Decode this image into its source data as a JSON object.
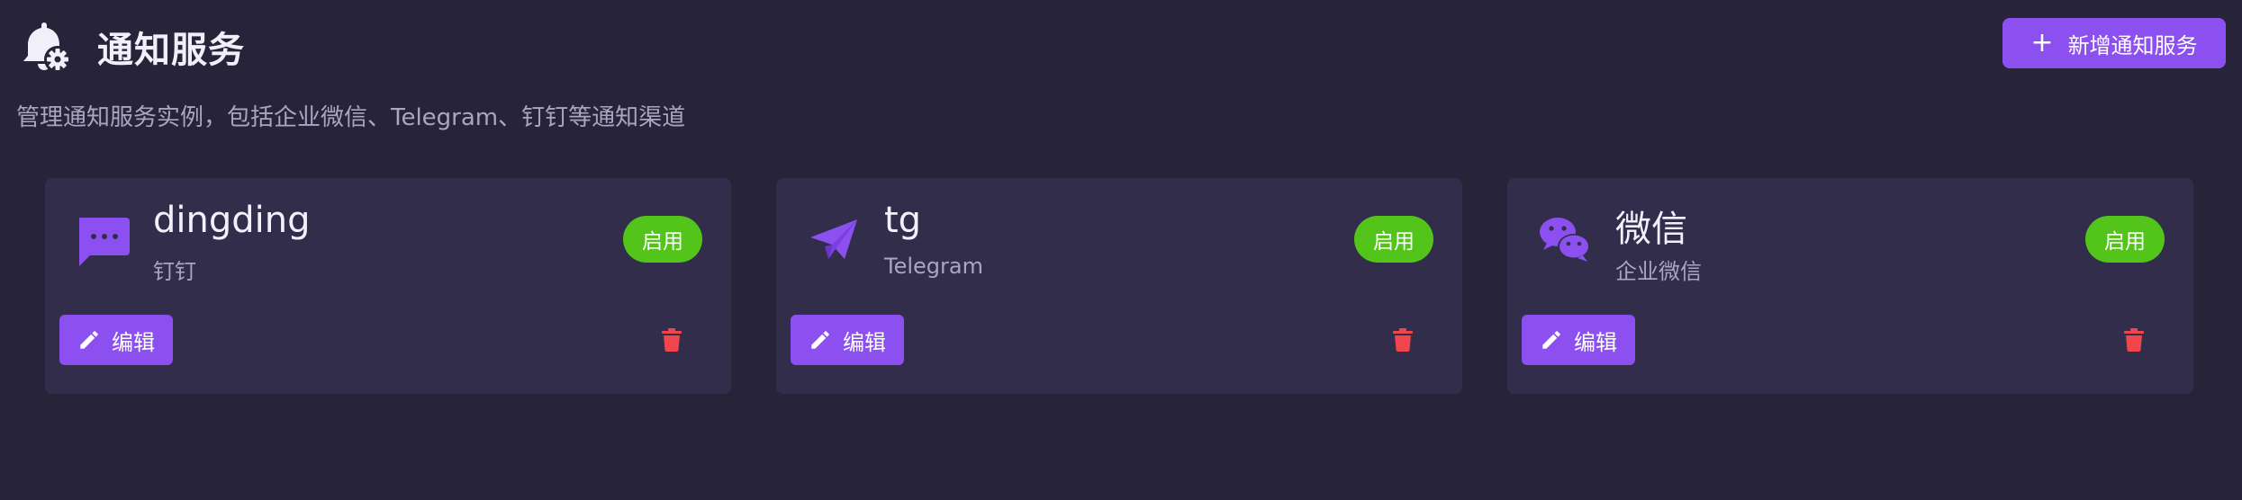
{
  "header": {
    "title": "通知服务",
    "subtitle": "管理通知服务实例，包括企业微信、Telegram、钉钉等通知渠道",
    "add_button_label": "新增通知服务",
    "icon": "bell-gear-icon"
  },
  "cards": [
    {
      "name": "dingding",
      "description": "钉钉",
      "icon": "chat-dots-icon",
      "status": "启用",
      "edit_label": "编辑"
    },
    {
      "name": "tg",
      "description": "Telegram",
      "icon": "paper-plane-icon",
      "status": "启用",
      "edit_label": "编辑"
    },
    {
      "name": "微信",
      "description": "企业微信",
      "icon": "wechat-icon",
      "status": "启用",
      "edit_label": "编辑"
    }
  ],
  "colors": {
    "background": "#27243a",
    "card": "#322d4a",
    "accent": "#8c4ff0",
    "status_enabled": "#52c41a",
    "danger": "#f0464b"
  }
}
